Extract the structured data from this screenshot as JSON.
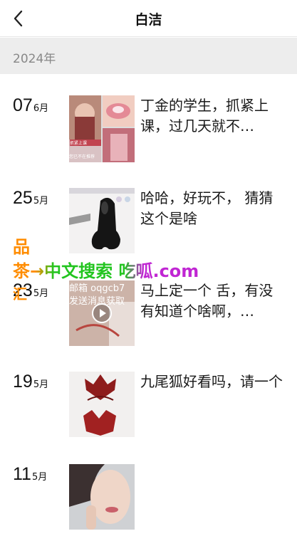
{
  "header": {
    "title": "白洁",
    "back_icon": "chevron-left-icon"
  },
  "year": "2024年",
  "entries": [
    {
      "day": "07",
      "month": "6月",
      "text": "丁金的学生，抓紧上课，过几天就不…",
      "thumb_type": "collage",
      "thumb_texts": [
        "抓紧上课",
        "您已不在推荐"
      ]
    },
    {
      "day": "25",
      "month": "5月",
      "text": "哈哈，好玩不， 猜猜这个是啥",
      "thumb_type": "black-object"
    },
    {
      "day": "23",
      "month": "5月",
      "text": "马上定一个 舌，有没有知道个啥啊，…",
      "thumb_type": "video",
      "thumb_texts": [
        "邮箱 oqgcb7",
        "发送消息获取"
      ]
    },
    {
      "day": "19",
      "month": "5月",
      "text": "九尾狐好看吗，请一个",
      "thumb_type": "red-objects"
    },
    {
      "day": "11",
      "month": "5月",
      "text": "",
      "thumb_type": "portrait"
    }
  ],
  "watermark": {
    "line1": "品",
    "line2": "茶→中文搜索 吃呱.com",
    "line3": "汇"
  },
  "colors": {
    "year_bar": "#ededed",
    "watermark_orange": "#ff8c00",
    "watermark_green": "#22c51f",
    "watermark_purple": "#c026d3"
  }
}
